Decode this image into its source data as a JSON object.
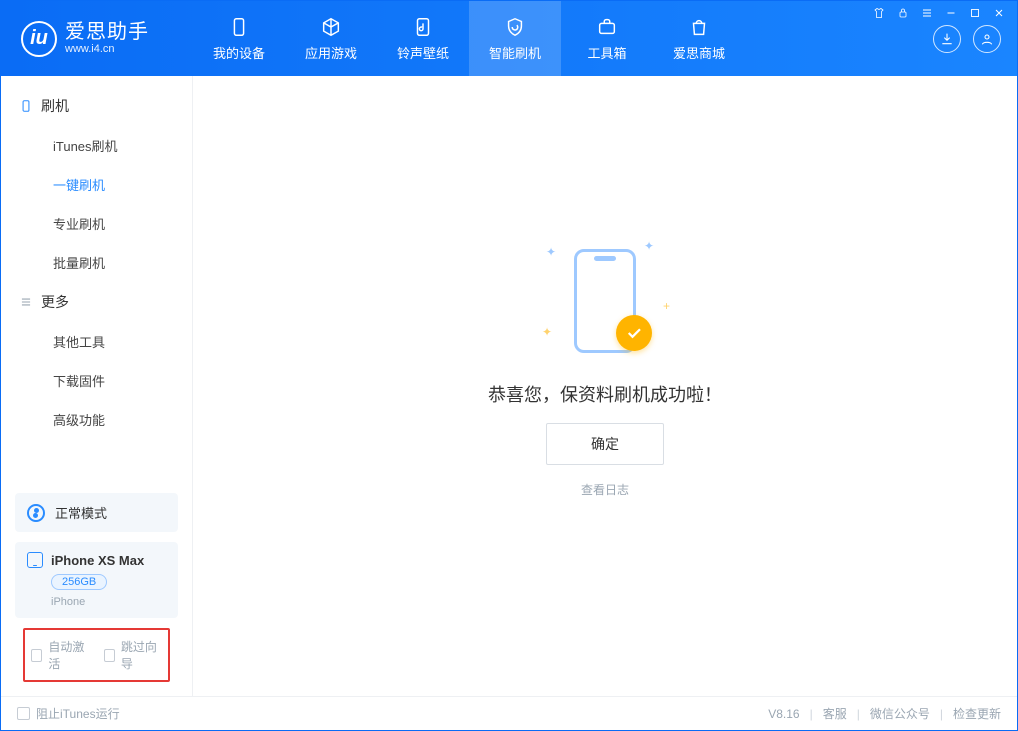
{
  "brand": {
    "name": "爱思助手",
    "url": "www.i4.cn"
  },
  "nav": {
    "tabs": [
      {
        "label": "我的设备"
      },
      {
        "label": "应用游戏"
      },
      {
        "label": "铃声壁纸"
      },
      {
        "label": "智能刷机"
      },
      {
        "label": "工具箱"
      },
      {
        "label": "爱思商城"
      }
    ],
    "active_index": 3
  },
  "sidebar": {
    "groups": [
      {
        "title": "刷机",
        "items": [
          {
            "label": "iTunes刷机"
          },
          {
            "label": "一键刷机",
            "active": true
          },
          {
            "label": "专业刷机"
          },
          {
            "label": "批量刷机"
          }
        ]
      },
      {
        "title": "更多",
        "items": [
          {
            "label": "其他工具"
          },
          {
            "label": "下载固件"
          },
          {
            "label": "高级功能"
          }
        ]
      }
    ],
    "mode": {
      "label": "正常模式"
    },
    "device": {
      "name": "iPhone XS Max",
      "storage": "256GB",
      "type": "iPhone"
    },
    "options": {
      "auto_activate": "自动激活",
      "skip_guide": "跳过向导"
    }
  },
  "main": {
    "success_text": "恭喜您，保资料刷机成功啦！",
    "ok_button": "确定",
    "view_log": "查看日志"
  },
  "footer": {
    "block_itunes": "阻止iTunes运行",
    "version": "V8.16",
    "links": {
      "support": "客服",
      "wechat": "微信公众号",
      "update": "检查更新"
    }
  }
}
